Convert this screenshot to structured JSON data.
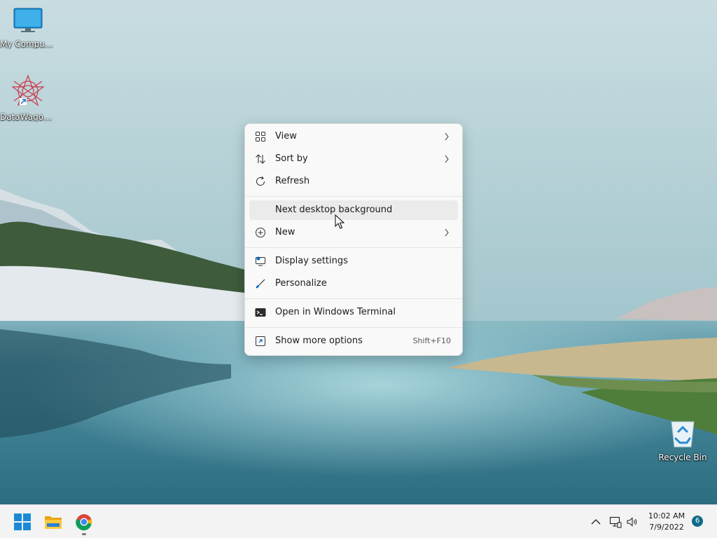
{
  "desktop": {
    "icons": [
      {
        "label": "My Computer",
        "icon": "monitor-icon"
      },
      {
        "label": "DataWagon...",
        "icon": "datawagon-logo-icon"
      },
      {
        "label": "Recycle Bin",
        "icon": "recycle-bin-icon"
      }
    ]
  },
  "context_menu": {
    "items": [
      {
        "label": "View",
        "icon": "grid-icon",
        "submenu": true
      },
      {
        "label": "Sort by",
        "icon": "sort-arrows-icon",
        "submenu": true
      },
      {
        "label": "Refresh",
        "icon": "refresh-icon"
      },
      {
        "label": "Next desktop background",
        "hovered": true
      },
      {
        "label": "New",
        "icon": "plus-circle-icon",
        "submenu": true
      },
      {
        "label": "Display settings",
        "icon": "display-settings-icon"
      },
      {
        "label": "Personalize",
        "icon": "brush-icon"
      },
      {
        "label": "Open in Windows Terminal",
        "icon": "terminal-icon"
      },
      {
        "label": "Show more options",
        "icon": "show-more-icon",
        "shortcut": "Shift+F10"
      }
    ]
  },
  "taskbar": {
    "apps": [
      {
        "name": "Start",
        "icon": "windows-start-icon"
      },
      {
        "name": "File Explorer",
        "icon": "folder-icon"
      },
      {
        "name": "Google Chrome",
        "icon": "chrome-icon",
        "running": true
      }
    ],
    "tray": {
      "icons": [
        "chevron-up-icon",
        "network-icon",
        "speaker-icon"
      ],
      "time": "10:02 AM",
      "date": "7/9/2022",
      "notification_count": "6"
    }
  },
  "colors": {
    "menu_bg": "#f9f9f9",
    "hover_bg": "#ebebeb",
    "accent": "#0067c0",
    "badge": "#0f6b87"
  }
}
